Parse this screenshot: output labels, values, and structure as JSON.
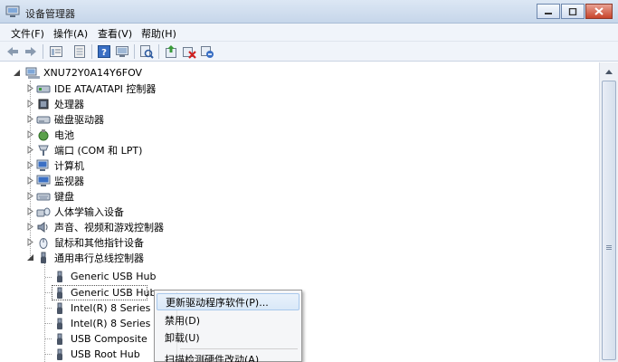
{
  "window": {
    "title": "设备管理器"
  },
  "menu": [
    "文件(F)",
    "操作(A)",
    "查看(V)",
    "帮助(H)"
  ],
  "toolbar": [
    "back-icon",
    "forward-icon",
    "properties-grid-icon",
    "help-book-icon",
    "help-icon",
    "monitor-icon",
    "scan-hardware-icon",
    "update-driver-icon",
    "uninstall-icon",
    "disable-icon"
  ],
  "tree": {
    "root": "XNU72Y0A14Y6FOV",
    "categories": [
      "IDE ATA/ATAPI 控制器",
      "处理器",
      "磁盘驱动器",
      "电池",
      "端口 (COM 和 LPT)",
      "计算机",
      "监视器",
      "键盘",
      "人体学输入设备",
      "声音、视频和游戏控制器",
      "鼠标和其他指针设备",
      "通用串行总线控制器"
    ],
    "usb_children": [
      "Generic USB Hub",
      "Generic USB Hub",
      "Intel(R) 8 Series",
      "Intel(R) 8 Series",
      "USB Composite",
      "USB Root Hub"
    ]
  },
  "context_menu": [
    "更新驱动程序软件(P)...",
    "禁用(D)",
    "卸载(U)",
    "扫描检测硬件改动(A)"
  ]
}
